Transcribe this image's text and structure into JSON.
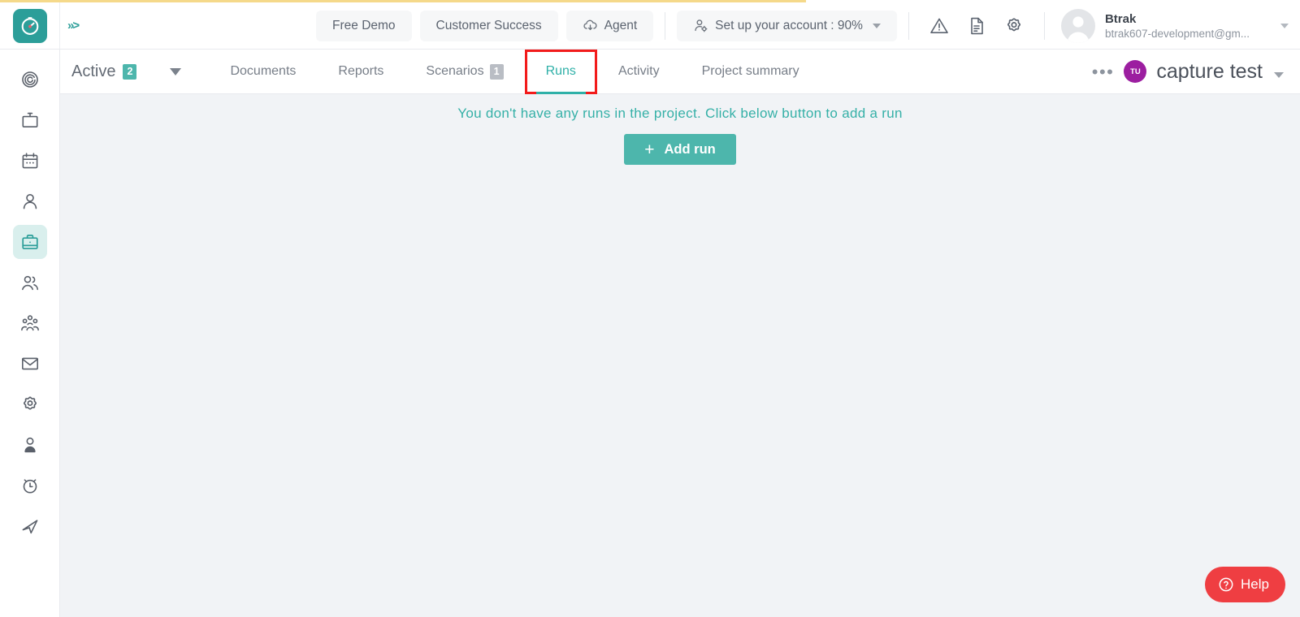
{
  "top_progress": {
    "percent": 62
  },
  "topbar": {
    "logo_icon": "clock-timer-logo-icon",
    "collapse_icon": "chevrons-right-icon",
    "buttons": [
      {
        "label": "Free Demo",
        "icon": null,
        "name": "free-demo-button"
      },
      {
        "label": "Customer Success",
        "icon": null,
        "name": "customer-success-button"
      },
      {
        "label": "Agent",
        "icon": "cloud-download-icon",
        "name": "agent-button"
      }
    ],
    "setup_account": {
      "label": "Set up your account : 90%",
      "icon": "user-gear-icon",
      "percent": 90
    },
    "icons": [
      {
        "name": "alert-triangle-icon",
        "title": "Alerts"
      },
      {
        "name": "document-icon",
        "title": "Documents"
      },
      {
        "name": "gear-icon",
        "title": "Settings"
      }
    ],
    "user": {
      "name": "Btrak",
      "email": "btrak607-development@gm...",
      "avatar_icon": "user-avatar-icon"
    }
  },
  "sidebar": {
    "items": [
      {
        "name": "sidebar-item-target",
        "icon": "target-spiral-icon",
        "active": false
      },
      {
        "name": "sidebar-item-monitor",
        "icon": "tv-monitor-icon",
        "active": false
      },
      {
        "name": "sidebar-item-calendar",
        "icon": "calendar-icon",
        "active": false
      },
      {
        "name": "sidebar-item-person",
        "icon": "person-icon",
        "active": false
      },
      {
        "name": "sidebar-item-projects",
        "icon": "briefcase-icon",
        "active": true
      },
      {
        "name": "sidebar-item-team",
        "icon": "people-icon",
        "active": false
      },
      {
        "name": "sidebar-item-organization",
        "icon": "org-group-icon",
        "active": false
      },
      {
        "name": "sidebar-item-mail",
        "icon": "envelope-icon",
        "active": false
      },
      {
        "name": "sidebar-item-settings",
        "icon": "gear-icon",
        "active": false
      },
      {
        "name": "sidebar-item-profile",
        "icon": "user-profile-icon",
        "active": false
      },
      {
        "name": "sidebar-item-timer",
        "icon": "alarm-clock-icon",
        "active": false
      },
      {
        "name": "sidebar-item-send",
        "icon": "paper-plane-icon",
        "active": false
      }
    ]
  },
  "tabbar": {
    "filter": {
      "label": "Active",
      "count": "2",
      "caret_icon": "caret-down-icon"
    },
    "tabs": [
      {
        "label": "Documents",
        "badge": null,
        "selected": false,
        "highlighted": false,
        "name": "tab-documents"
      },
      {
        "label": "Reports",
        "badge": null,
        "selected": false,
        "highlighted": false,
        "name": "tab-reports"
      },
      {
        "label": "Scenarios",
        "badge": "1",
        "selected": false,
        "highlighted": false,
        "name": "tab-scenarios"
      },
      {
        "label": "Runs",
        "badge": null,
        "selected": true,
        "highlighted": true,
        "name": "tab-runs"
      },
      {
        "label": "Activity",
        "badge": null,
        "selected": false,
        "highlighted": false,
        "name": "tab-activity"
      },
      {
        "label": "Project summary",
        "badge": null,
        "selected": false,
        "highlighted": false,
        "name": "tab-project-summary"
      }
    ],
    "more_label": "•••",
    "project": {
      "initials": "TU",
      "name": "capture test",
      "avatar_color": "#9c1ea0"
    }
  },
  "content": {
    "empty_message": "You don't have any runs in the project. Click below button to add a run",
    "add_run_label": "Add run",
    "add_run_plus": "+"
  },
  "help": {
    "label": "Help",
    "icon": "question-circle-icon"
  },
  "colors": {
    "accent_teal": "#4db6ac",
    "brand_teal": "#2c9e99",
    "highlight_red": "#f21b1b",
    "help_red": "#ef3e42",
    "progress_yellow": "#f5d98a",
    "project_purple": "#9c1ea0",
    "content_bg": "#f1f3f6"
  }
}
